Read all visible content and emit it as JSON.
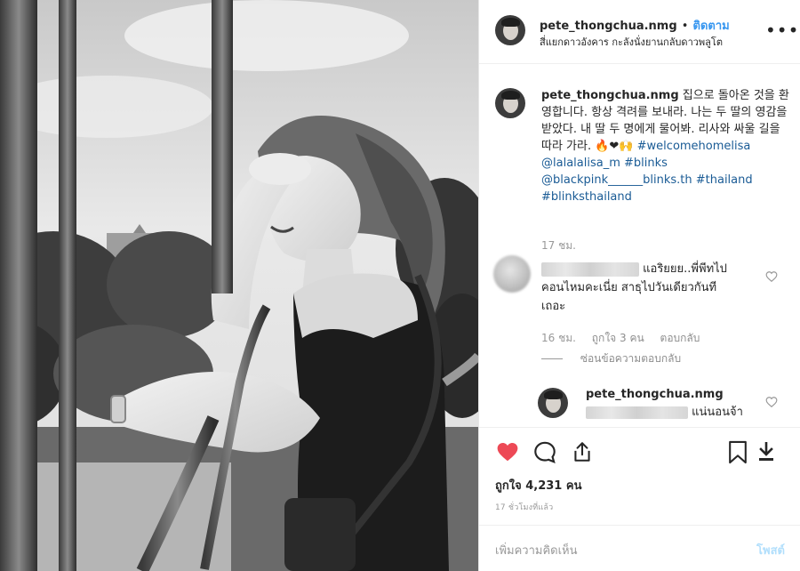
{
  "post": {
    "author": "pete_thongchua.nmg",
    "follow_label": "ติดตาม",
    "separator": "•",
    "location": "สี่แยกดาวอังคาร กะลังนั่งยานกลับดาวพลูโต",
    "more_label": "•••"
  },
  "caption": {
    "author": "pete_thongchua.nmg",
    "text": "집으로 돌아온 것을 환영합니다. 항상 격려를 보내라. 나는 두 딸의 영감을 받았다. 내 딸 두 명에게 물어봐. 리사와 싸울 길을 따라 가라.",
    "emoji": "🔥❤🙌",
    "tags_line1": "#welcomehomelisa",
    "tags_line2": "@lalalalisa_m #blinks",
    "tags_line3": "@blackpink______blinks.th #thailand",
    "tags_line4": "#blinksthailand",
    "age": "17 ชม."
  },
  "comment1": {
    "text_line1": "แอริยยย..พี่พีทไป",
    "text_line2": "คอนไหมคะเนี่ย สาธุไปวันเดียวกันที",
    "text_line3": "เถอะ",
    "age": "16 ชม.",
    "likes": "ถูกใจ 3 คน",
    "reply": "ตอบกลับ",
    "hide_replies": "ซ่อนข้อความตอบกลับ"
  },
  "reply1": {
    "author": "pete_thongchua.nmg",
    "text": "แน่นอนจ้า"
  },
  "actions": {
    "likes_text": "ถูกใจ 4,231 คน",
    "time": "17 ชั่วโมงที่แล้ว",
    "heart_color": "#ed4956",
    "icons": [
      "heart-icon",
      "comment-icon",
      "share-icon",
      "bookmark-icon",
      "download-icon"
    ]
  },
  "composer": {
    "placeholder": "เพิ่มความคิดเห็น",
    "post_label": "โพสต์"
  }
}
